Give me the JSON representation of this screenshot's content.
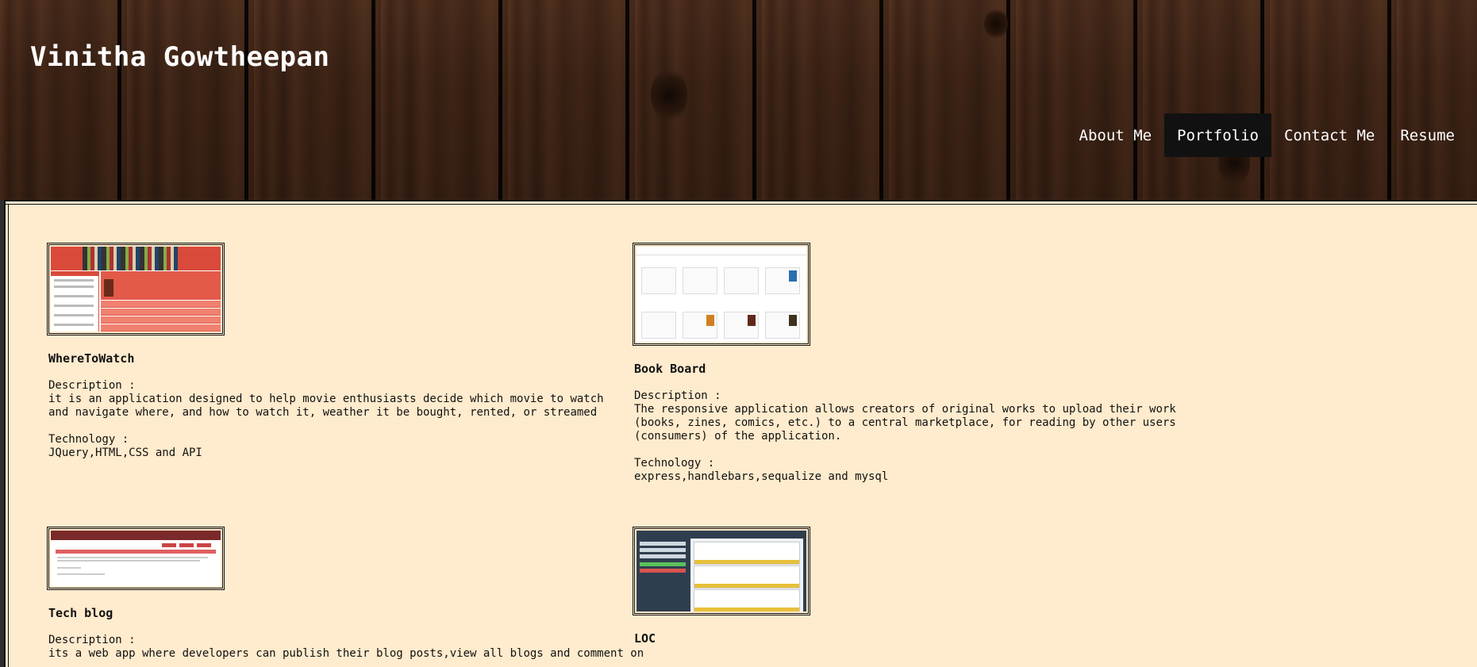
{
  "header": {
    "site_title": "Vinitha Gowtheepan"
  },
  "nav": {
    "items": [
      {
        "label": "About Me",
        "active": false
      },
      {
        "label": "Portfolio",
        "active": true
      },
      {
        "label": "Contact Me",
        "active": false
      },
      {
        "label": "Resume",
        "active": false
      }
    ]
  },
  "projects": [
    {
      "title": "WhereToWatch",
      "description_label": "Description :",
      "description": "it is an application designed to help movie enthusiasts decide which movie to watch and navigate where, and how to watch it, weather it be bought, rented, or streamed",
      "technology_label": "Technology :",
      "technology": "JQuery,HTML,CSS and API"
    },
    {
      "title": "Book Board",
      "description_label": "Description :",
      "description": "The responsive application allows creators of original works to upload their work (books, zines, comics, etc.) to a central marketplace, for reading by other users (consumers) of the application.",
      "technology_label": "Technology :",
      "technology": "express,handlebars,sequalize and mysql"
    },
    {
      "title": "Tech blog",
      "description_label": "Description :",
      "description": "its a web app where developers can publish their blog posts,view all blogs and comment on"
    },
    {
      "title": "LOC"
    }
  ],
  "colors": {
    "content_bg": "#ffebcd",
    "nav_active_bg": "#111111",
    "title_text": "#ffffff"
  }
}
